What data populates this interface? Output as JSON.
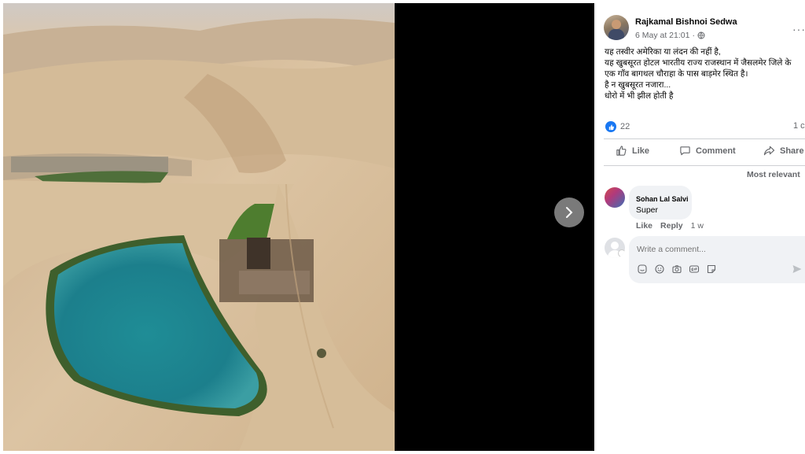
{
  "post": {
    "author": "Rajkamal Bishnoi Sedwa",
    "timestamp": "6 May at 21:01",
    "separator": "·",
    "more_label": "···",
    "caption_lines": [
      "यह तस्वीर अमेरिका या लंदन की नहीं है,",
      "यह खुबसूरत होटल भारतीय राज्य राजस्थान में जैसलमेर जिले के",
      "एक गाँव बागथल चौराहा के पास बाड़मेर स्थित है।",
      "है न खुबसूरत नजारा...",
      "धोरो में भी झील होती है"
    ],
    "likes_count": "22",
    "comments_count": "1 c"
  },
  "actions": {
    "like": "Like",
    "comment": "Comment",
    "share": "Share"
  },
  "comments": {
    "sort_label": "Most relevant",
    "items": [
      {
        "author": "Sohan Lal Salvi",
        "text": "Super",
        "like_label": "Like",
        "reply_label": "Reply",
        "age": "1 w"
      }
    ],
    "input_placeholder": "Write a comment..."
  },
  "viewer": {
    "next_icon": "chevron-right-icon"
  },
  "colors": {
    "accent": "#1877f2",
    "secondary_text": "#65676b",
    "bubble_bg": "#f0f2f5"
  }
}
